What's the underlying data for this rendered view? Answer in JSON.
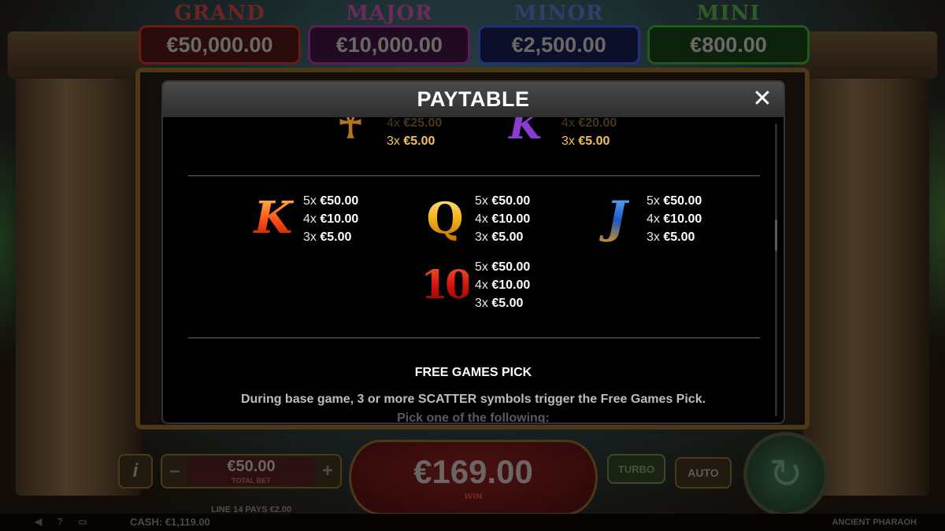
{
  "jackpots": [
    {
      "name": "GRAND",
      "value": "€50,000.00",
      "name_color": "#6b2424",
      "border": "#6b1a1a",
      "bg": "#2a0c0c"
    },
    {
      "name": "MAJOR",
      "value": "€10,000.00",
      "name_color": "#6a2a5a",
      "border": "#5a1f5a",
      "bg": "#200b22"
    },
    {
      "name": "MINOR",
      "value": "€2,500.00",
      "name_color": "#2f3f6a",
      "border": "#22307a",
      "bg": "#0c0f2a"
    },
    {
      "name": "MINI",
      "value": "€800.00",
      "name_color": "#2f5a2a",
      "border": "#1f5a1c",
      "bg": "#0c220b"
    }
  ],
  "bottom_bar": {
    "info_label": "i",
    "minus_label": "–",
    "plus_label": "+",
    "total_bet_value": "€50.00",
    "total_bet_label": "TOTAL BET",
    "line_pays": "LINE 14 PAYS €2.00",
    "win_value": "€169.00",
    "win_label": "WIN",
    "turbo_label": "TURBO",
    "auto_label": "AUTO",
    "spin_icon": "↻"
  },
  "status_bar": {
    "icons": "◀ ? ▭",
    "cash": "CASH: €1,119.00",
    "game_name": "ANCIENT PHARAOH"
  },
  "paytable": {
    "title": "PAYTABLE",
    "close_icon": "✕",
    "top_partial": [
      {
        "symbol": "ankh",
        "glyph": "☥",
        "lines": [
          {
            "count": "4x",
            "amount": "€25.00",
            "style": "fade"
          },
          {
            "count": "3x",
            "amount": "€5.00",
            "style": "gold"
          }
        ]
      },
      {
        "symbol": "k-purple",
        "glyph": "K",
        "lines": [
          {
            "count": "4x",
            "amount": "€20.00",
            "style": "fade"
          },
          {
            "count": "3x",
            "amount": "€5.00",
            "style": "gold"
          }
        ]
      }
    ],
    "entries": [
      {
        "symbol": "K",
        "lines": [
          {
            "count": "5x",
            "amount": "€50.00"
          },
          {
            "count": "4x",
            "amount": "€10.00"
          },
          {
            "count": "3x",
            "amount": "€5.00"
          }
        ]
      },
      {
        "symbol": "Q",
        "lines": [
          {
            "count": "5x",
            "amount": "€50.00"
          },
          {
            "count": "4x",
            "amount": "€10.00"
          },
          {
            "count": "3x",
            "amount": "€5.00"
          }
        ]
      },
      {
        "symbol": "J",
        "lines": [
          {
            "count": "5x",
            "amount": "€50.00"
          },
          {
            "count": "4x",
            "amount": "€10.00"
          },
          {
            "count": "3x",
            "amount": "€5.00"
          }
        ]
      },
      {
        "symbol": "10",
        "lines": [
          {
            "count": "5x",
            "amount": "€50.00"
          },
          {
            "count": "4x",
            "amount": "€10.00"
          },
          {
            "count": "3x",
            "amount": "€5.00"
          }
        ]
      }
    ],
    "free_games_title": "FREE GAMES PICK",
    "free_games_text": "During base game, 3 or more SCATTER symbols trigger the Free Games Pick.",
    "free_games_text_2": "Pick one of the following:"
  }
}
